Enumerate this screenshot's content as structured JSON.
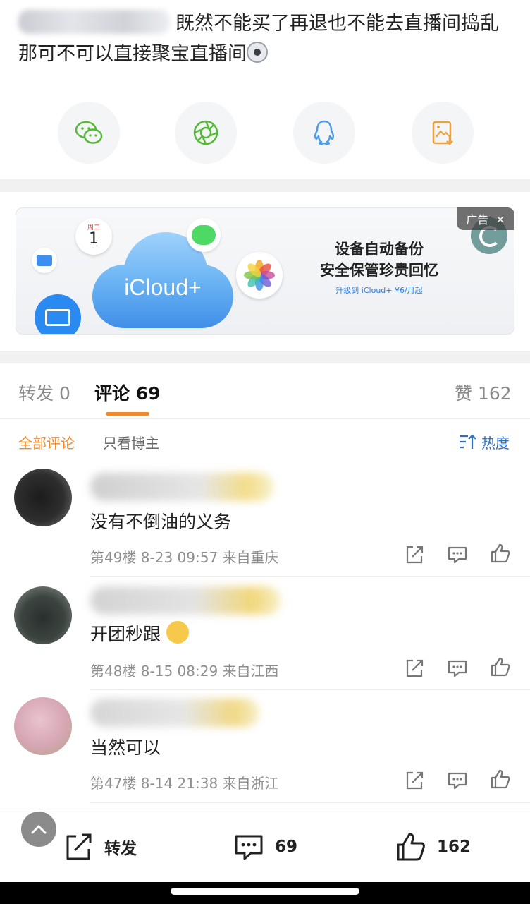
{
  "post": {
    "text": "既然不能买了再退也不能去直播间捣乱那可不可以直接聚宝直播间"
  },
  "share": {
    "wechat_icon": "wechat-icon",
    "moments_icon": "moments-icon",
    "qq_icon": "qq-icon",
    "save_image_icon": "save-image-icon"
  },
  "ad": {
    "calendar_day_label": "周二",
    "calendar_day_number": "1",
    "brand": "iCloud+",
    "title_line1": "设备自动备份",
    "title_line2": "安全保管珍贵回忆",
    "subtitle": "升级到 iCloud+ ¥6/月起",
    "badge_label": "广告",
    "close_label": "×"
  },
  "tabs": {
    "repost_label": "转发",
    "repost_count": "0",
    "comments_label": "评论",
    "comments_count": "69",
    "likes_label": "赞",
    "likes_count": "162"
  },
  "filters": {
    "all_label": "全部评论",
    "author_only_label": "只看博主",
    "sort_label": "热度"
  },
  "comments": [
    {
      "text": "没有不倒油的义务",
      "meta": "第49楼 8-23 09:57 来自重庆"
    },
    {
      "text": "开团秒跟",
      "meta": "第48楼 8-15 08:29 来自江西"
    },
    {
      "text": "当然可以",
      "meta": "第47楼 8-14 21:38 来自浙江"
    }
  ],
  "bottom_bar": {
    "repost_label": "转发",
    "comments_count": "69",
    "likes_count": "162"
  },
  "colors": {
    "accent": "#f08a2c",
    "wechat_green": "#55b837",
    "qq_blue": "#4a9de8",
    "save_orange": "#f0a23a"
  }
}
